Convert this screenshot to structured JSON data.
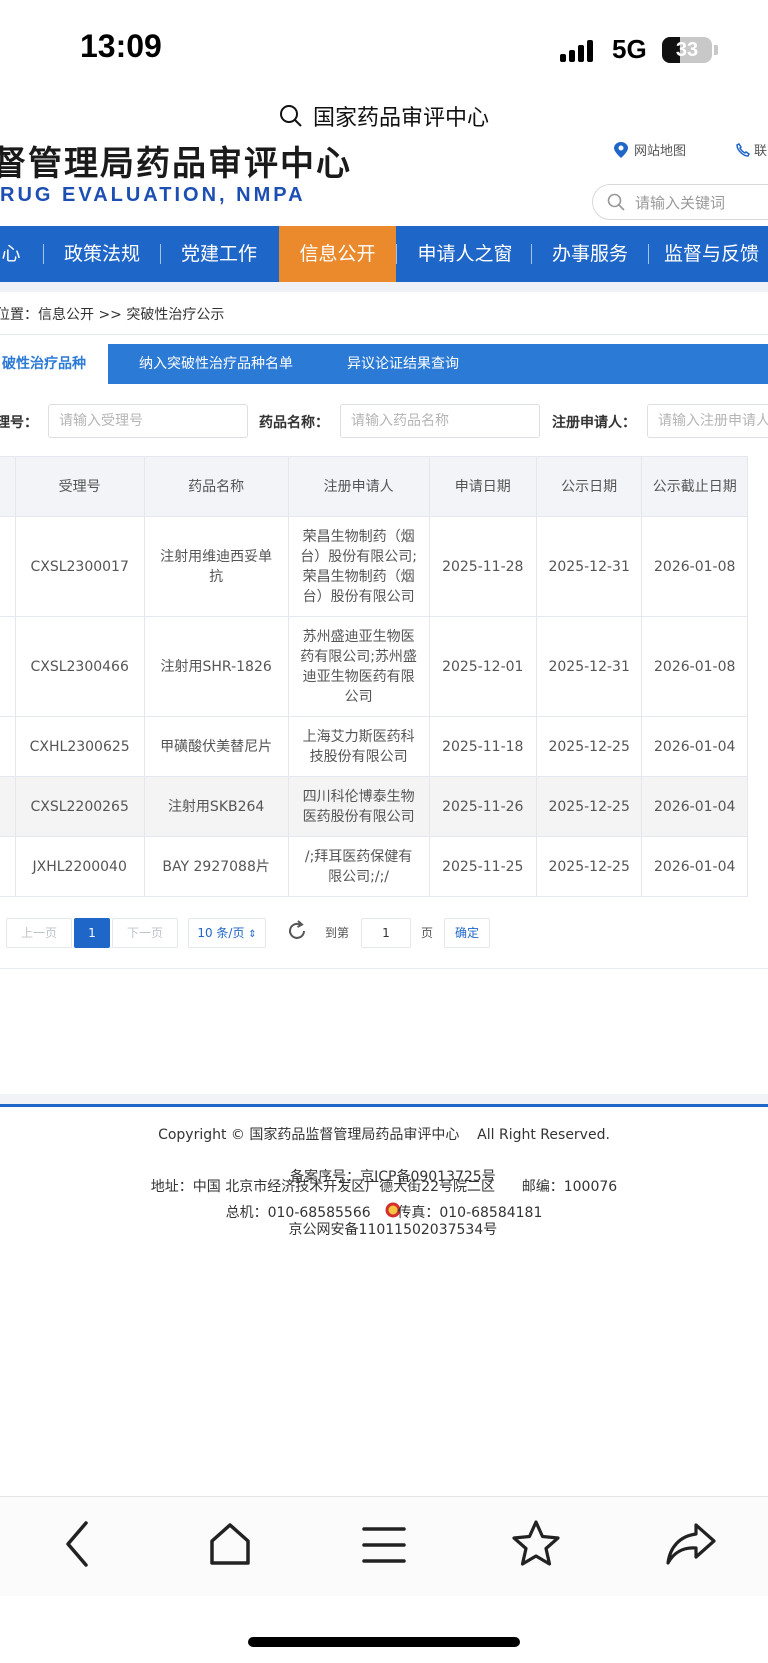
{
  "status": {
    "time": "13:09",
    "network": "5G",
    "battery": "33"
  },
  "browser": {
    "url_title": "国家药品审评中心"
  },
  "header": {
    "title_cn": "督管理局药品审评中心",
    "title_en": "RUG EVALUATION, NMPA",
    "sitemap": "网站地图",
    "contact": "联",
    "search_placeholder": "请输入关键词"
  },
  "nav": {
    "items": [
      "心",
      "政策法规",
      "党建工作",
      "信息公开",
      "申请人之窗",
      "办事服务",
      "监督与反馈"
    ],
    "active": "信息公开"
  },
  "breadcrumb": "位置：信息公开 >> 突破性治疗公示",
  "tabs": [
    "破性治疗品种",
    "纳入突破性治疗品种名单",
    "异议论证结果查询"
  ],
  "filters": {
    "accept_label": "理号：",
    "accept_placeholder": "请输入受理号",
    "drug_label": "药品名称：",
    "drug_placeholder": "请输入药品名称",
    "applicant_label": "注册申请人：",
    "applicant_placeholder": "请输入注册申请人"
  },
  "table": {
    "headers": [
      "受理号",
      "药品名称",
      "注册申请人",
      "申请日期",
      "公示日期",
      "公示截止日期"
    ],
    "rows": [
      [
        "CXSL2300017",
        "注射用维迪西妥单抗",
        "荣昌生物制药（烟台）股份有限公司;荣昌生物制药（烟台）股份有限公司",
        "2025-11-28",
        "2025-12-31",
        "2026-01-08"
      ],
      [
        "CXSL2300466",
        "注射用SHR-1826",
        "苏州盛迪亚生物医药有限公司;苏州盛迪亚生物医药有限公司",
        "2025-12-01",
        "2025-12-31",
        "2026-01-08"
      ],
      [
        "CXHL2300625",
        "甲磺酸伏美替尼片",
        "上海艾力斯医药科技股份有限公司",
        "2025-11-18",
        "2025-12-25",
        "2026-01-04"
      ],
      [
        "CXSL2200265",
        "注射用SKB264",
        "四川科伦博泰生物医药股份有限公司",
        "2025-11-26",
        "2025-12-25",
        "2026-01-04"
      ],
      [
        "JXHL2200040",
        "BAY 2927088片",
        "/;拜耳医药保健有限公司;/;/",
        "2025-11-25",
        "2025-12-25",
        "2026-01-04"
      ]
    ]
  },
  "pagination": {
    "prev": "上一页",
    "page": "1",
    "next": "下一页",
    "page_size": "10 条/页",
    "goto": "到第",
    "goto_value": "1",
    "page_unit": "页",
    "confirm": "确定"
  },
  "footer": {
    "copyright": "Copyright © 国家药品监督管理局药品审评中心    All Right Reserved.",
    "icp": "备案序号：京ICP备09013725号",
    "police": "京公网安备11011502037534号",
    "address": "地址：中国 北京市经济技术开发区广德大街22号院二区      邮编：100076",
    "phone": "总机：010-68585566      传真：010-68584181"
  }
}
